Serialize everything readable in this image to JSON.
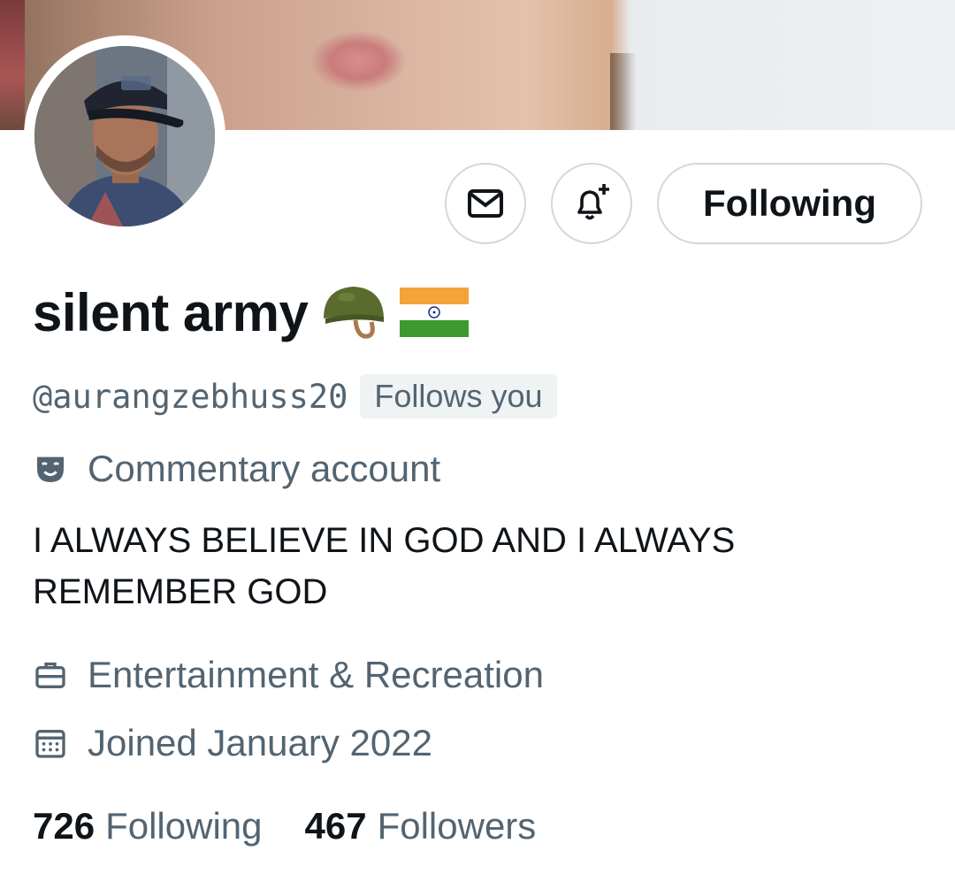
{
  "profile": {
    "display_name": "silent army",
    "name_emojis": [
      "military-helmet-emoji",
      "india-flag-emoji"
    ],
    "handle": "@aurangzebhuss20",
    "follows_you_badge": "Follows you",
    "label": "Commentary account",
    "bio": "I ALWAYS BELIEVE IN GOD AND I ALWAYS REMEMBER GOD",
    "category": "Entertainment & Recreation",
    "joined": "Joined January 2022"
  },
  "actions": {
    "message_icon": "envelope-icon",
    "notify_icon": "bell-plus-icon",
    "follow_label": "Following"
  },
  "stats": {
    "following_count": "726",
    "following_label": "Following",
    "followers_count": "467",
    "followers_label": "Followers"
  },
  "colors": {
    "primary_text": "#0f1419",
    "secondary_text": "#536471",
    "border": "#cfd9de",
    "badge_bg": "#eff3f4"
  }
}
